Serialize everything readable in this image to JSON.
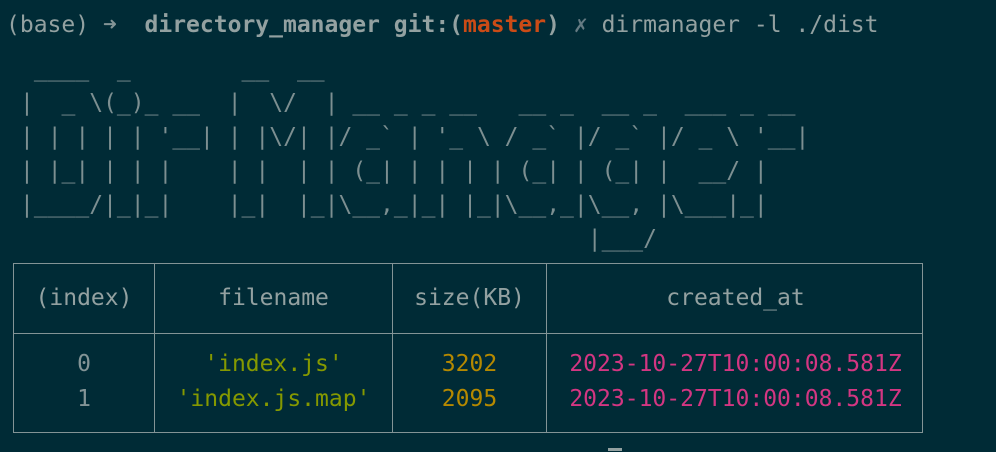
{
  "prompt": {
    "env": "(base)",
    "arrow": "➜",
    "directory": "directory_manager",
    "git_prefix": "git:(",
    "branch": "master",
    "git_suffix": ")",
    "dirty_mark": "✗",
    "command": "dirmanager -l ./dist"
  },
  "banner": {
    "ascii_lines": [
      " ____  _        __  __",
      "|  _ \\(_)_ __  |  \\/  | __ _ _ __   __ _  __ _  ___ _ __",
      "| | | | | '__| | |\\/| |/ _` | '_ \\ / _` |/ _` |/ _ \\ '__|",
      "| |_| | | |    | |  | | (_| | | | | (_| | (_| |  __/ |",
      "|____/|_|_|    |_|  |_|\\__,_|_| |_|\\__,_|\\__, |\\___|_|",
      "                                         |___/"
    ]
  },
  "table": {
    "headers": [
      "(index)",
      "filename",
      "size(KB)",
      "created_at"
    ],
    "rows": [
      {
        "index": "0",
        "filename": "'index.js'",
        "size": "3202",
        "created_at": "2023-10-27T10:00:08.581Z"
      },
      {
        "index": "1",
        "filename": "'index.js.map'",
        "size": "2095",
        "created_at": "2023-10-27T10:00:08.581Z"
      }
    ]
  },
  "colors": {
    "background": "#002b36",
    "text": "#93a1a1",
    "branch": "#cb4b16",
    "string": "#859900",
    "number": "#b58900",
    "date": "#d33682"
  },
  "icons": {
    "prompt_arrow": "arrow-right-icon",
    "dirty": "cross-icon"
  }
}
